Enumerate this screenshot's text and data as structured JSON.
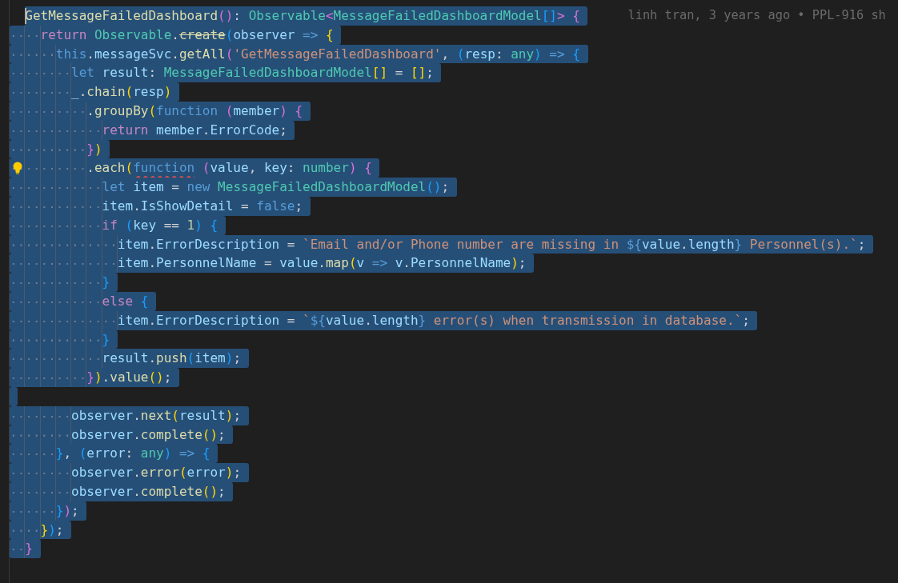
{
  "editor": {
    "lines": [
      {
        "selected": true,
        "cursor": true,
        "blame": "linh tran, 3 years ago • PPL-916 sh",
        "tokens": [
          {
            "kind": "fn",
            "text": "  GetMessageFailedDashboard"
          },
          {
            "kind": "b2",
            "text": "()"
          },
          {
            "kind": "p",
            "text": ": "
          },
          {
            "kind": "type",
            "text": "Observable"
          },
          {
            "kind": "b2",
            "text": "<"
          },
          {
            "kind": "type",
            "text": "MessageFailedDashboardModel"
          },
          {
            "kind": "b3",
            "text": "[]"
          },
          {
            "kind": "b2",
            "text": ">"
          },
          {
            "kind": "b2",
            "text": " {"
          }
        ]
      },
      {
        "selected": true,
        "tokens": [
          {
            "kind": "ctl",
            "text": "    return"
          },
          {
            "kind": "type",
            "text": " Observable"
          },
          {
            "kind": "p",
            "text": "."
          },
          {
            "kind": "fn",
            "text": "create",
            "deprecated": true
          },
          {
            "kind": "b3",
            "text": "("
          },
          {
            "kind": "var",
            "text": "observer"
          },
          {
            "kind": "kw",
            "text": " =>"
          },
          {
            "kind": "b1",
            "text": " {"
          }
        ]
      },
      {
        "selected": true,
        "tokens": [
          {
            "kind": "kw",
            "text": "      this"
          },
          {
            "kind": "p",
            "text": "."
          },
          {
            "kind": "var",
            "text": "messageSvc"
          },
          {
            "kind": "p",
            "text": "."
          },
          {
            "kind": "fn",
            "text": "getAll"
          },
          {
            "kind": "b2",
            "text": "("
          },
          {
            "kind": "str",
            "text": "'GetMessageFailedDashboard'"
          },
          {
            "kind": "p",
            "text": ", "
          },
          {
            "kind": "b3",
            "text": "("
          },
          {
            "kind": "var",
            "text": "resp"
          },
          {
            "kind": "p",
            "text": ": "
          },
          {
            "kind": "type",
            "text": "any"
          },
          {
            "kind": "b3",
            "text": ")"
          },
          {
            "kind": "kw",
            "text": " =>"
          },
          {
            "kind": "b3",
            "text": " {"
          }
        ]
      },
      {
        "selected": true,
        "tokens": [
          {
            "kind": "kw",
            "text": "        let"
          },
          {
            "kind": "var",
            "text": " result"
          },
          {
            "kind": "p",
            "text": ": "
          },
          {
            "kind": "type",
            "text": "MessageFailedDashboardModel"
          },
          {
            "kind": "b1",
            "text": "[]"
          },
          {
            "kind": "p",
            "text": " = "
          },
          {
            "kind": "b1",
            "text": "[]"
          },
          {
            "kind": "p",
            "text": ";"
          }
        ]
      },
      {
        "selected": true,
        "tokens": [
          {
            "kind": "var",
            "text": "        _"
          },
          {
            "kind": "p",
            "text": "."
          },
          {
            "kind": "fn",
            "text": "chain"
          },
          {
            "kind": "b1",
            "text": "("
          },
          {
            "kind": "var",
            "text": "resp"
          },
          {
            "kind": "b1",
            "text": ")"
          }
        ]
      },
      {
        "selected": true,
        "tokens": [
          {
            "kind": "p",
            "text": "          ."
          },
          {
            "kind": "fn",
            "text": "groupBy"
          },
          {
            "kind": "b1",
            "text": "("
          },
          {
            "kind": "kw",
            "text": "function"
          },
          {
            "kind": "b2",
            "text": " ("
          },
          {
            "kind": "var",
            "text": "member"
          },
          {
            "kind": "b2",
            "text": ")"
          },
          {
            "kind": "b2",
            "text": " {"
          }
        ]
      },
      {
        "selected": true,
        "tokens": [
          {
            "kind": "ctl",
            "text": "            return"
          },
          {
            "kind": "var",
            "text": " member"
          },
          {
            "kind": "p",
            "text": "."
          },
          {
            "kind": "var",
            "text": "ErrorCode"
          },
          {
            "kind": "p",
            "text": ";"
          }
        ]
      },
      {
        "selected": true,
        "tokens": [
          {
            "kind": "b2",
            "text": "          }"
          },
          {
            "kind": "b1",
            "text": ")"
          }
        ]
      },
      {
        "selected": true,
        "lightbulb": true,
        "tokens": [
          {
            "kind": "p",
            "text": "          ."
          },
          {
            "kind": "fn",
            "text": "each"
          },
          {
            "kind": "b1",
            "text": "("
          },
          {
            "kind": "kw",
            "text": "function",
            "error": true
          },
          {
            "kind": "b2",
            "text": " ("
          },
          {
            "kind": "var",
            "text": "value"
          },
          {
            "kind": "p",
            "text": ", "
          },
          {
            "kind": "var",
            "text": "key"
          },
          {
            "kind": "p",
            "text": ": "
          },
          {
            "kind": "type",
            "text": "number"
          },
          {
            "kind": "b2",
            "text": ")"
          },
          {
            "kind": "b2",
            "text": " {"
          }
        ]
      },
      {
        "selected": true,
        "tokens": [
          {
            "kind": "kw",
            "text": "            let"
          },
          {
            "kind": "var",
            "text": " item"
          },
          {
            "kind": "p",
            "text": " = "
          },
          {
            "kind": "kw",
            "text": "new"
          },
          {
            "kind": "type",
            "text": " MessageFailedDashboardModel"
          },
          {
            "kind": "b3",
            "text": "()"
          },
          {
            "kind": "p",
            "text": ";"
          }
        ]
      },
      {
        "selected": true,
        "tokens": [
          {
            "kind": "var",
            "text": "            item"
          },
          {
            "kind": "p",
            "text": "."
          },
          {
            "kind": "var",
            "text": "IsShowDetail"
          },
          {
            "kind": "p",
            "text": " = "
          },
          {
            "kind": "kw",
            "text": "false"
          },
          {
            "kind": "p",
            "text": ";"
          }
        ]
      },
      {
        "selected": true,
        "tokens": [
          {
            "kind": "ctl",
            "text": "            if"
          },
          {
            "kind": "b3",
            "text": " ("
          },
          {
            "kind": "var",
            "text": "key"
          },
          {
            "kind": "p",
            "text": " == "
          },
          {
            "kind": "num",
            "text": "1"
          },
          {
            "kind": "b3",
            "text": ")"
          },
          {
            "kind": "b3",
            "text": " {"
          }
        ]
      },
      {
        "selected": true,
        "tokens": [
          {
            "kind": "var",
            "text": "              item"
          },
          {
            "kind": "p",
            "text": "."
          },
          {
            "kind": "var",
            "text": "ErrorDescription"
          },
          {
            "kind": "p",
            "text": " = "
          },
          {
            "kind": "str",
            "text": "`Email and/or Phone number are missing in "
          },
          {
            "kind": "kw",
            "text": "${"
          },
          {
            "kind": "var",
            "text": "value"
          },
          {
            "kind": "p",
            "text": "."
          },
          {
            "kind": "var",
            "text": "length"
          },
          {
            "kind": "kw",
            "text": "}"
          },
          {
            "kind": "str",
            "text": " Personnel(s).`"
          },
          {
            "kind": "p",
            "text": ";"
          }
        ]
      },
      {
        "selected": true,
        "tokens": [
          {
            "kind": "var",
            "text": "              item"
          },
          {
            "kind": "p",
            "text": "."
          },
          {
            "kind": "var",
            "text": "PersonnelName"
          },
          {
            "kind": "p",
            "text": " = "
          },
          {
            "kind": "var",
            "text": "value"
          },
          {
            "kind": "p",
            "text": "."
          },
          {
            "kind": "fn",
            "text": "map"
          },
          {
            "kind": "b1",
            "text": "("
          },
          {
            "kind": "var",
            "text": "v"
          },
          {
            "kind": "kw",
            "text": " =>"
          },
          {
            "kind": "var",
            "text": " v"
          },
          {
            "kind": "p",
            "text": "."
          },
          {
            "kind": "var",
            "text": "PersonnelName"
          },
          {
            "kind": "b1",
            "text": ")"
          },
          {
            "kind": "p",
            "text": ";"
          }
        ]
      },
      {
        "selected": true,
        "tokens": [
          {
            "kind": "b3",
            "text": "            }"
          }
        ]
      },
      {
        "selected": true,
        "tokens": [
          {
            "kind": "ctl",
            "text": "            else"
          },
          {
            "kind": "b3",
            "text": " {"
          }
        ]
      },
      {
        "selected": true,
        "tokens": [
          {
            "kind": "var",
            "text": "              item"
          },
          {
            "kind": "p",
            "text": "."
          },
          {
            "kind": "var",
            "text": "ErrorDescription"
          },
          {
            "kind": "p",
            "text": " = "
          },
          {
            "kind": "str",
            "text": "`"
          },
          {
            "kind": "kw",
            "text": "${"
          },
          {
            "kind": "var",
            "text": "value"
          },
          {
            "kind": "p",
            "text": "."
          },
          {
            "kind": "var",
            "text": "length"
          },
          {
            "kind": "kw",
            "text": "}"
          },
          {
            "kind": "str",
            "text": " error(s) when transmission in database.`"
          },
          {
            "kind": "p",
            "text": ";"
          }
        ]
      },
      {
        "selected": true,
        "tokens": [
          {
            "kind": "b3",
            "text": "            }"
          }
        ]
      },
      {
        "selected": true,
        "tokens": [
          {
            "kind": "var",
            "text": "            result"
          },
          {
            "kind": "p",
            "text": "."
          },
          {
            "kind": "fn",
            "text": "push"
          },
          {
            "kind": "b3",
            "text": "("
          },
          {
            "kind": "var",
            "text": "item"
          },
          {
            "kind": "b3",
            "text": ")"
          },
          {
            "kind": "p",
            "text": ";"
          }
        ]
      },
      {
        "selected": true,
        "tokens": [
          {
            "kind": "b2",
            "text": "          }"
          },
          {
            "kind": "b1",
            "text": ")"
          },
          {
            "kind": "p",
            "text": "."
          },
          {
            "kind": "fn",
            "text": "value"
          },
          {
            "kind": "b1",
            "text": "()"
          },
          {
            "kind": "p",
            "text": ";"
          }
        ]
      },
      {
        "selected": true
      },
      {
        "selected": true,
        "tokens": [
          {
            "kind": "var",
            "text": "        observer"
          },
          {
            "kind": "p",
            "text": "."
          },
          {
            "kind": "fn",
            "text": "next"
          },
          {
            "kind": "b1",
            "text": "("
          },
          {
            "kind": "var",
            "text": "result"
          },
          {
            "kind": "b1",
            "text": ")"
          },
          {
            "kind": "p",
            "text": ";"
          }
        ]
      },
      {
        "selected": true,
        "tokens": [
          {
            "kind": "var",
            "text": "        observer"
          },
          {
            "kind": "p",
            "text": "."
          },
          {
            "kind": "fn",
            "text": "complete"
          },
          {
            "kind": "b1",
            "text": "()"
          },
          {
            "kind": "p",
            "text": ";"
          }
        ]
      },
      {
        "selected": true,
        "tokens": [
          {
            "kind": "b3",
            "text": "      }"
          },
          {
            "kind": "p",
            "text": ", "
          },
          {
            "kind": "b3",
            "text": "("
          },
          {
            "kind": "var",
            "text": "error"
          },
          {
            "kind": "p",
            "text": ": "
          },
          {
            "kind": "type",
            "text": "any"
          },
          {
            "kind": "b3",
            "text": ")"
          },
          {
            "kind": "kw",
            "text": " =>"
          },
          {
            "kind": "b3",
            "text": " {"
          }
        ]
      },
      {
        "selected": true,
        "tokens": [
          {
            "kind": "var",
            "text": "        observer"
          },
          {
            "kind": "p",
            "text": "."
          },
          {
            "kind": "fn",
            "text": "error"
          },
          {
            "kind": "b1",
            "text": "("
          },
          {
            "kind": "var",
            "text": "error"
          },
          {
            "kind": "b1",
            "text": ")"
          },
          {
            "kind": "p",
            "text": ";"
          }
        ]
      },
      {
        "selected": true,
        "tokens": [
          {
            "kind": "var",
            "text": "        observer"
          },
          {
            "kind": "p",
            "text": "."
          },
          {
            "kind": "fn",
            "text": "complete"
          },
          {
            "kind": "b1",
            "text": "()"
          },
          {
            "kind": "p",
            "text": ";"
          }
        ]
      },
      {
        "selected": true,
        "tokens": [
          {
            "kind": "b3",
            "text": "      }"
          },
          {
            "kind": "b2",
            "text": ")"
          },
          {
            "kind": "p",
            "text": ";"
          }
        ]
      },
      {
        "selected": true,
        "tokens": [
          {
            "kind": "b1",
            "text": "    }"
          },
          {
            "kind": "b3",
            "text": ")"
          },
          {
            "kind": "p",
            "text": ";"
          }
        ]
      },
      {
        "selected": true,
        "tokens": [
          {
            "kind": "b2",
            "text": "  }"
          }
        ]
      }
    ]
  }
}
